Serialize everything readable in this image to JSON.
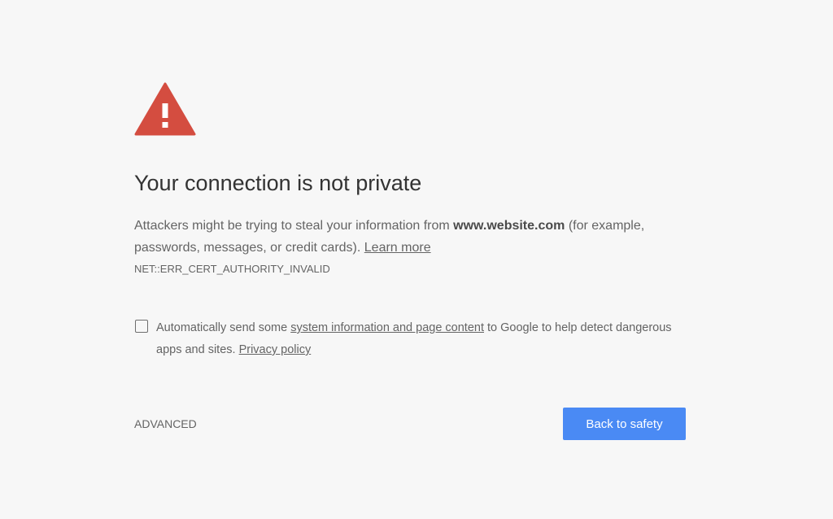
{
  "icon": "warning-triangle-icon",
  "colors": {
    "warning": "#d44d40",
    "button": "#4a8af4",
    "background": "#f7f7f7"
  },
  "title": "Your connection is not private",
  "message": {
    "text_before": "Attackers might be trying to steal your information from ",
    "host": "www.website.com",
    "text_after": "  (for example, passwords, messages, or credit cards). ",
    "learn_more": "Learn more"
  },
  "error_code": "NET::ERR_CERT_AUTHORITY_INVALID",
  "reporting": {
    "checked": false,
    "text_before": "Automatically send some ",
    "link": "system information and page content",
    "text_middle": " to Google to help detect dangerous apps and sites. ",
    "privacy_link": "Privacy policy"
  },
  "advanced_label": "ADVANCED",
  "back_button_label": "Back to safety"
}
